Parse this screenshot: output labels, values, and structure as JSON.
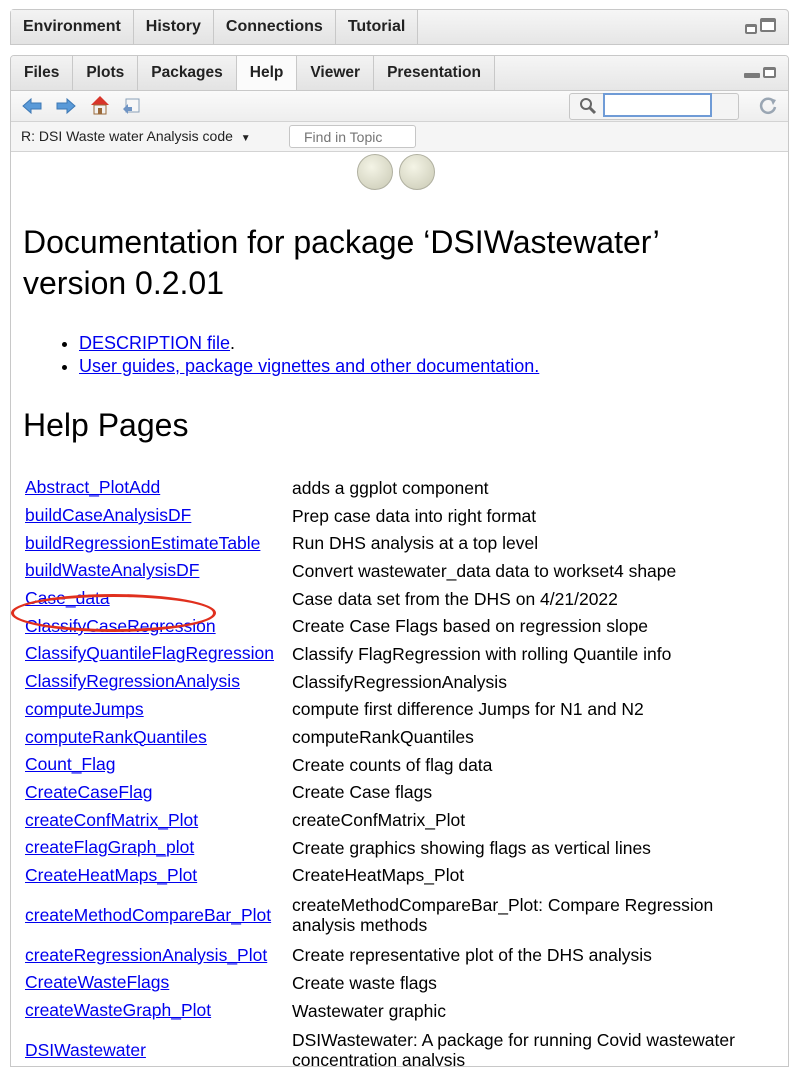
{
  "top_pane": {
    "tabs": [
      "Environment",
      "History",
      "Connections",
      "Tutorial"
    ]
  },
  "bottom_pane": {
    "tabs": [
      "Files",
      "Plots",
      "Packages",
      "Help",
      "Viewer",
      "Presentation"
    ],
    "active_tab": "Help"
  },
  "toolbar": {
    "icons": [
      "back-arrow-icon",
      "forward-arrow-icon",
      "home-icon",
      "print-icon",
      "search-icon",
      "refresh-icon"
    ],
    "search_value": ""
  },
  "subbar": {
    "topic": "R: DSI Waste water Analysis code",
    "find_placeholder": "Find in Topic"
  },
  "doc": {
    "title": "Documentation for package ‘DSIWastewater’ version 0.2.01",
    "links": [
      {
        "text": "DESCRIPTION file",
        "suffix": "."
      },
      {
        "text": "User guides, package vignettes and other documentation.",
        "suffix": ""
      }
    ],
    "help_pages_heading": "Help Pages",
    "help_pages": [
      {
        "name": "Abstract_PlotAdd",
        "desc": "adds a ggplot component"
      },
      {
        "name": "buildCaseAnalysisDF",
        "desc": "Prep case data into right format"
      },
      {
        "name": "buildRegressionEstimateTable",
        "desc": "Run DHS analysis at a top level"
      },
      {
        "name": "buildWasteAnalysisDF",
        "desc": "Convert wastewater_data data to workset4 shape"
      },
      {
        "name": "Case_data",
        "desc": "Case data set from the DHS on 4/21/2022"
      },
      {
        "name": "ClassifyCaseRegression",
        "desc": "Create Case Flags based on regression slope"
      },
      {
        "name": "ClassifyQuantileFlagRegression",
        "desc": "Classify FlagRegression with rolling Quantile info"
      },
      {
        "name": "ClassifyRegressionAnalysis",
        "desc": "ClassifyRegressionAnalysis"
      },
      {
        "name": "computeJumps",
        "desc": "compute first difference Jumps for N1 and N2"
      },
      {
        "name": "computeRankQuantiles",
        "desc": "computeRankQuantiles"
      },
      {
        "name": "Count_Flag",
        "desc": "Create counts of flag data"
      },
      {
        "name": "CreateCaseFlag",
        "desc": "Create Case flags"
      },
      {
        "name": "createConfMatrix_Plot",
        "desc": "createConfMatrix_Plot"
      },
      {
        "name": "createFlagGraph_plot",
        "desc": "Create graphics showing flags as vertical lines"
      },
      {
        "name": "CreateHeatMaps_Plot",
        "desc": "CreateHeatMaps_Plot"
      },
      {
        "name": "createMethodCompareBar_Plot",
        "desc": "createMethodCompareBar_Plot: Compare Regression analysis methods"
      },
      {
        "name": "createRegressionAnalysis_Plot",
        "desc": "Create representative plot of the DHS analysis"
      },
      {
        "name": "CreateWasteFlags",
        "desc": "Create waste flags"
      },
      {
        "name": "createWasteGraph_Plot",
        "desc": "Wastewater graphic"
      },
      {
        "name": "DSIWastewater",
        "desc": "DSIWastewater: A package for running Covid wastewater concentration analysis"
      }
    ],
    "highlight": {
      "target": "buildCaseAnalysisDF",
      "color": "#e0301e"
    }
  }
}
